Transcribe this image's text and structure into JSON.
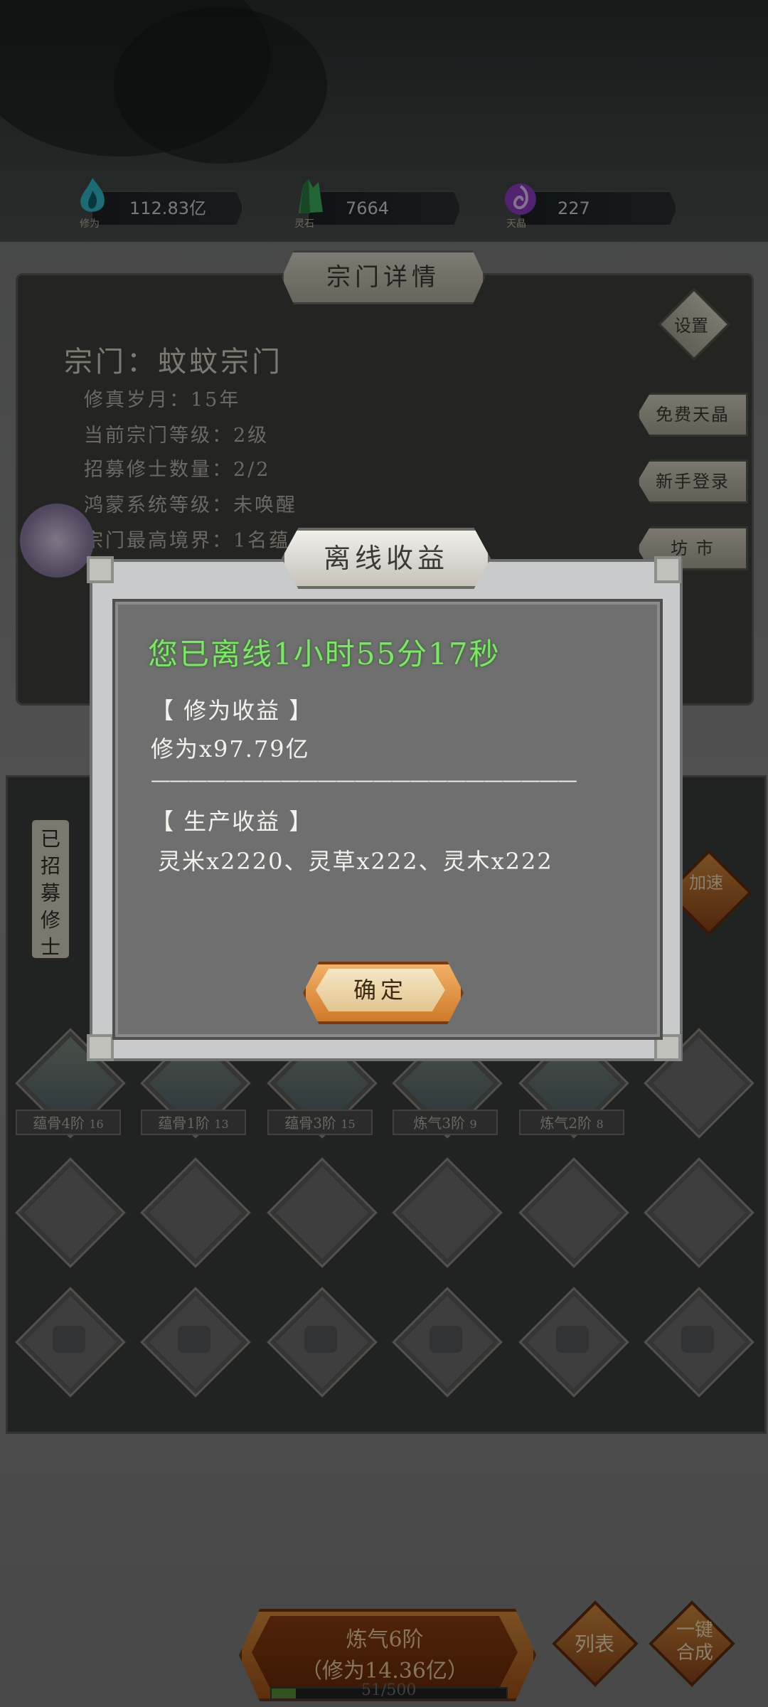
{
  "resources": [
    {
      "icon": "cultivation-flame-icon",
      "caption": "修为",
      "value": "112.83亿",
      "color": "#2fb7c9"
    },
    {
      "icon": "spirit-stone-icon",
      "caption": "灵石",
      "value": "7664",
      "color": "#3fae5c"
    },
    {
      "icon": "heaven-crystal-icon",
      "caption": "天晶",
      "value": "227",
      "color": "#8b3bbf"
    }
  ],
  "panel": {
    "title": "宗门详情",
    "sect_name": "宗门：蚊蚊宗门",
    "info": [
      "修真岁月：15年",
      "当前宗门等级：2级",
      "招募修士数量：2/2",
      "鸿蒙系统等级：未唤醒",
      "宗门最高境界：1名蕴"
    ],
    "settings_label": "设置",
    "side_buttons": [
      "免费天晶",
      "新手登录",
      "坊 市"
    ]
  },
  "disciples": {
    "recruited_label": "已招募修士",
    "speed_label": "加速",
    "tags": [
      {
        "text": "蕴骨4阶",
        "count": "16"
      },
      {
        "text": "蕴骨1阶",
        "count": "13"
      },
      {
        "text": "蕴骨3阶",
        "count": "15"
      },
      {
        "text": "炼气3阶",
        "count": "9"
      },
      {
        "text": "炼气2阶",
        "count": "8"
      }
    ]
  },
  "bottom": {
    "level_line1": "炼气6阶",
    "level_line2": "（修为14.36亿）",
    "list_label": "列表",
    "merge_label": "一键合成",
    "progress_text": "51/500",
    "progress_fraction": 0.102
  },
  "modal": {
    "title": "离线收益",
    "offline_line": "您已离线1小时55分17秒",
    "section1_header": "【 修为收益 】",
    "section1_value": "修为x97.79亿",
    "divider": "———————————————————————",
    "section2_header": "【 生产收益 】",
    "section2_value": "灵米x2220、灵草x222、灵木x222",
    "confirm": "确定"
  }
}
